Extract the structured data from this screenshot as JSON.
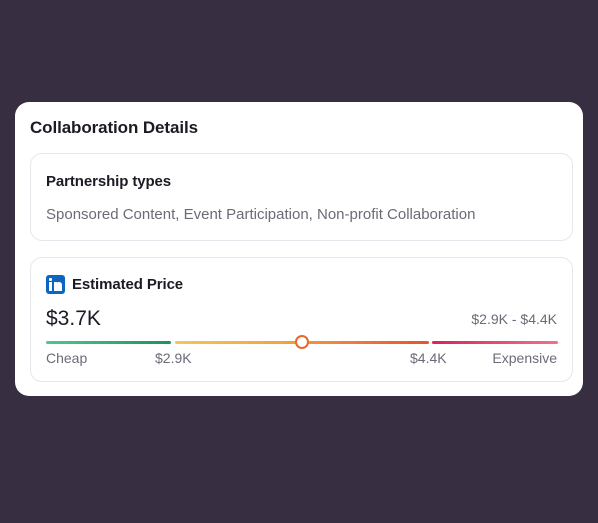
{
  "card": {
    "title": "Collaboration Details"
  },
  "partnership": {
    "heading": "Partnership types",
    "value": "Sponsored Content, Event Participation, Non-profit Collaboration"
  },
  "price": {
    "icon": "linkedin-icon",
    "heading": "Estimated Price",
    "value": "$3.7K",
    "range": "$2.9K - $4.4K",
    "position_fraction": 0.5,
    "labels": {
      "cheap": "Cheap",
      "min": "$2.9K",
      "max": "$4.4K",
      "expensive": "Expensive"
    }
  },
  "colors": {
    "background": "#382e42",
    "linkedin": "#0a66c2",
    "cheap": "#18955a",
    "mid": "#f5a638",
    "expensive": "#e8265c"
  }
}
